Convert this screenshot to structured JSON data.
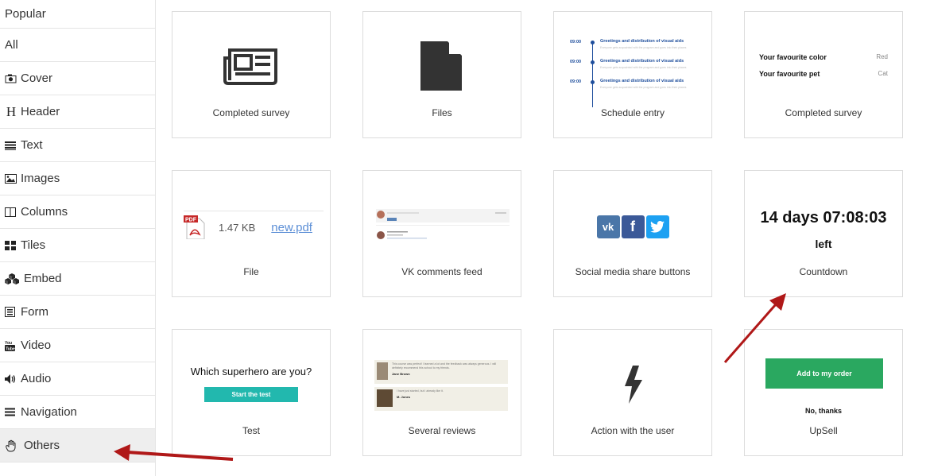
{
  "sidebar": {
    "items": [
      {
        "label": "Popular",
        "icon": ""
      },
      {
        "label": "All",
        "icon": ""
      },
      {
        "label": "Cover",
        "icon": "camera-icon"
      },
      {
        "label": "Header",
        "icon": "header-h-icon"
      },
      {
        "label": "Text",
        "icon": "text-lines-icon"
      },
      {
        "label": "Images",
        "icon": "image-icon"
      },
      {
        "label": "Columns",
        "icon": "columns-icon"
      },
      {
        "label": "Tiles",
        "icon": "tiles-icon"
      },
      {
        "label": "Embed",
        "icon": "cubes-icon"
      },
      {
        "label": "Form",
        "icon": "form-icon"
      },
      {
        "label": "Video",
        "icon": "youtube-icon"
      },
      {
        "label": "Audio",
        "icon": "speaker-icon"
      },
      {
        "label": "Navigation",
        "icon": "menu-icon"
      },
      {
        "label": "Others",
        "icon": "hand-icon"
      }
    ],
    "active": "Others"
  },
  "blocks": {
    "completed_survey_1": {
      "label": "Completed survey"
    },
    "files": {
      "label": "Files"
    },
    "schedule": {
      "label": "Schedule entry",
      "rows": [
        {
          "time": "09:00",
          "title": "Greetings and distribution of visual aids",
          "sub": "Everyone gets acquainted with the program and goes into their places"
        },
        {
          "time": "09:00",
          "title": "Greetings and distribution of visual aids",
          "sub": "Everyone gets acquainted with the program and goes into their places"
        },
        {
          "time": "09:00",
          "title": "Greetings and distribution of visual aids",
          "sub": "Everyone gets acquainted with the program and goes into their places"
        }
      ]
    },
    "completed_survey_2": {
      "label": "Completed survey",
      "rows": [
        {
          "key": "Your favourite color",
          "value": "Red"
        },
        {
          "key": "Your favourite pet",
          "value": "Cat"
        }
      ]
    },
    "file": {
      "label": "File",
      "size": "1.47 KB",
      "name": "new.pdf",
      "pdf_badge": "PDF"
    },
    "vk_feed": {
      "label": "VK comments feed"
    },
    "social": {
      "label": "Social media share buttons",
      "colors": {
        "vk": "#4a76a8",
        "fb": "#3b5998",
        "tw": "#1da1f2"
      }
    },
    "countdown": {
      "label": "Countdown",
      "time": "14 days 07:08:03",
      "suffix": "left"
    },
    "test": {
      "label": "Test",
      "question": "Which superhero are you?",
      "button": "Start the test"
    },
    "reviews": {
      "label": "Several reviews",
      "items": [
        {
          "text": "This course was perfect! I learned a lot and the feedback was always generous. I will definitely recommend this school to my friends.",
          "name": "Jane Brown"
        },
        {
          "text": "I have just started, but I already like it.",
          "name": "M. Jones"
        }
      ]
    },
    "action": {
      "label": "Action with the user"
    },
    "upsell": {
      "label": "UpSell",
      "button": "Add to my order",
      "decline": "No, thanks"
    }
  }
}
